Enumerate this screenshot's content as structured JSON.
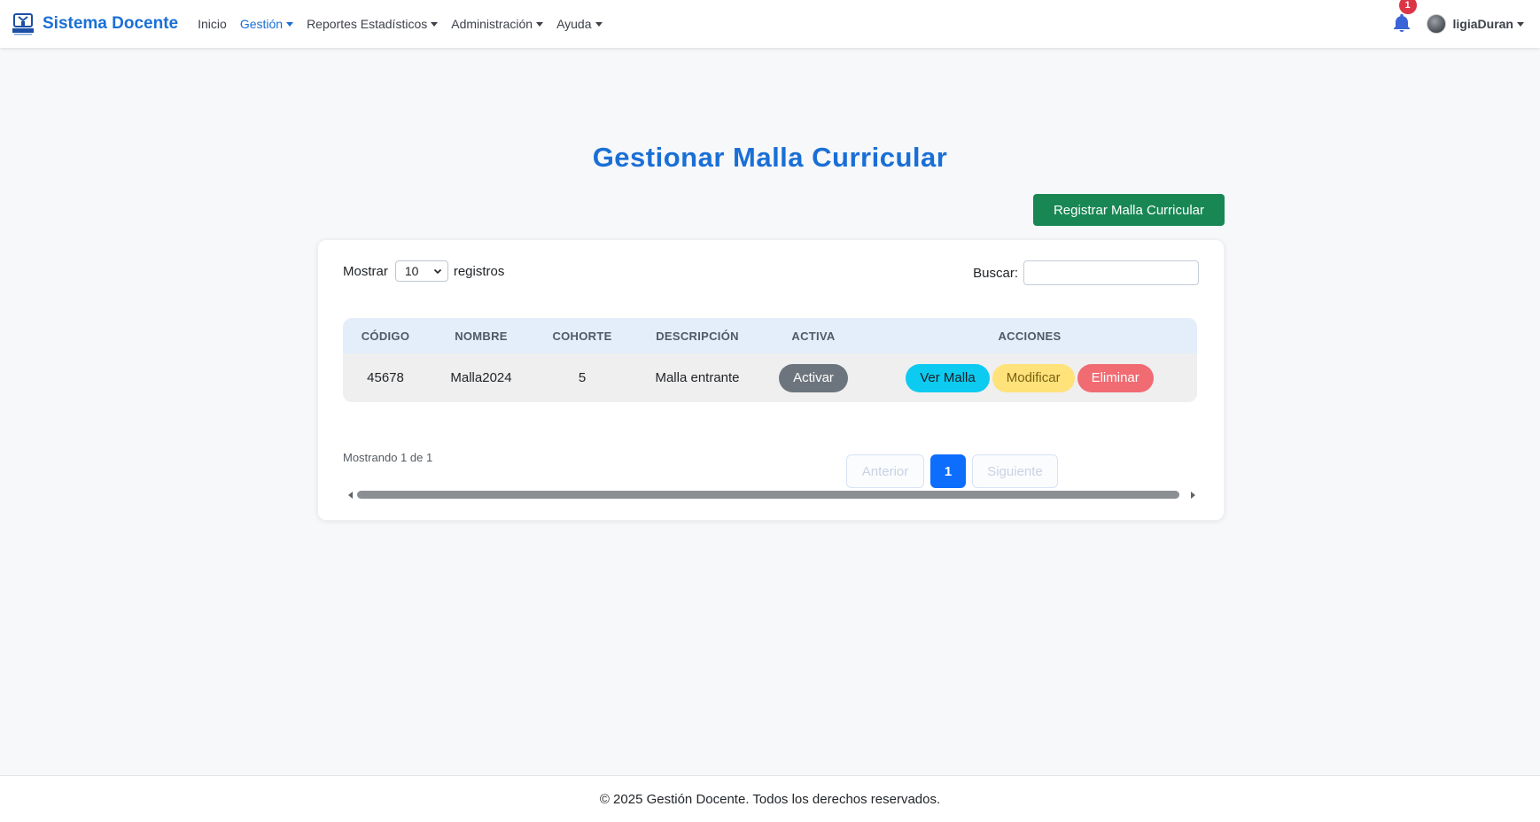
{
  "navbar": {
    "brand": "Sistema Docente",
    "logo_icon": "uptaeb-logo-icon",
    "menu": [
      {
        "label": "Inicio",
        "has_caret": false,
        "active": false
      },
      {
        "label": "Gestión",
        "has_caret": true,
        "active": true
      },
      {
        "label": "Reportes Estadísticos",
        "has_caret": true,
        "active": false
      },
      {
        "label": "Administración",
        "has_caret": true,
        "active": false
      },
      {
        "label": "Ayuda",
        "has_caret": true,
        "active": false
      }
    ],
    "notifications_count": "1",
    "username": "ligiaDuran"
  },
  "page": {
    "title": "Gestionar Malla Curricular",
    "register_button": "Registrar Malla Curricular"
  },
  "table_controls": {
    "show_label": "Mostrar",
    "page_length": "10",
    "records_label": "registros",
    "search_label": "Buscar:",
    "search_value": ""
  },
  "table": {
    "columns": [
      "CÓDIGO",
      "NOMBRE",
      "COHORTE",
      "DESCRIPCIÓN",
      "ACTIVA",
      "ACCIONES"
    ],
    "rows": [
      {
        "codigo": "45678",
        "nombre": "Malla2024",
        "cohorte": "5",
        "descripcion": "Malla entrante",
        "activa_button": "Activar",
        "actions": {
          "view": "Ver Malla",
          "edit": "Modificar",
          "delete": "Eliminar"
        }
      }
    ]
  },
  "pagination": {
    "info": "Mostrando 1 de 1",
    "prev": "Anterior",
    "current": "1",
    "next": "Siguiente"
  },
  "footer": {
    "text": "© 2025 Gestión Docente. Todos los derechos reservados."
  },
  "colors": {
    "brand_blue": "#1a6fd6",
    "success_green": "#198754",
    "primary_blue": "#0d6efd"
  }
}
